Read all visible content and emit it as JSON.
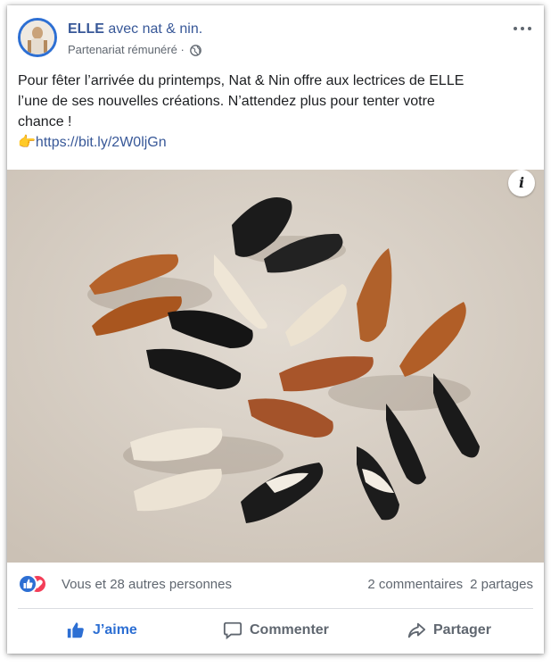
{
  "post": {
    "page_name": "ELLE",
    "with_text": "avec nat & nin.",
    "sponsor_label": "Partenariat rémunéré ·",
    "text_line1": "Pour fêter l’arrivée du printemps, Nat & Nin offre aux lectrices de ELLE",
    "text_line2": "l’une de ses nouvelles créations. N’attendez plus pour tenter votre",
    "text_line3": "chance !",
    "link_emoji": "👉",
    "link": "https://bit.ly/2W0ljGn",
    "info_icon_text": "i"
  },
  "stats": {
    "reactions_text": "Vous et 28 autres personnes",
    "comments": "2 commentaires",
    "shares": "2 partages"
  },
  "actions": {
    "like_label": "J’aime",
    "comment_label": "Commenter",
    "share_label": "Partager"
  },
  "colors": {
    "facebook_blue": "#385898",
    "like_blue": "#2d6fd3",
    "love_red": "#f33e58",
    "muted_text": "#606770"
  }
}
